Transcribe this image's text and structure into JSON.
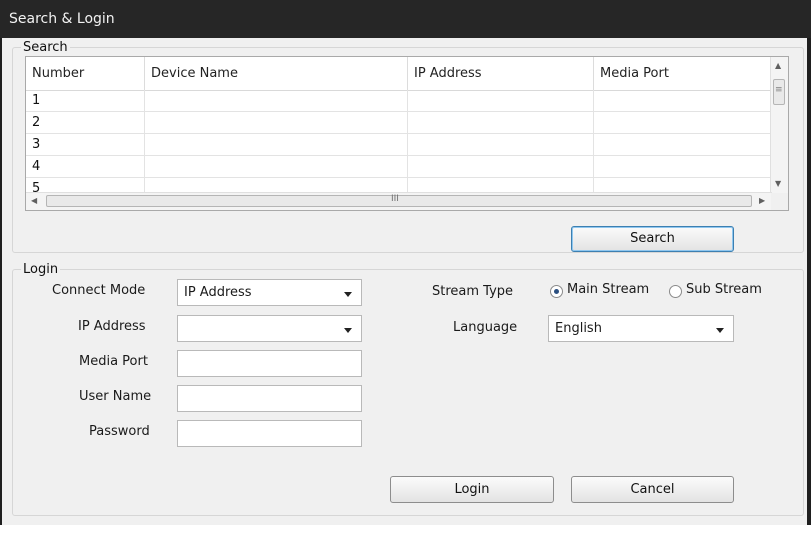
{
  "window": {
    "title": "Search & Login"
  },
  "search": {
    "group_title": "Search",
    "columns": [
      "Number",
      "Device Name",
      "IP Address",
      "Media Port"
    ],
    "rows": [
      [
        "1",
        "",
        "",
        ""
      ],
      [
        "2",
        "",
        "",
        ""
      ],
      [
        "3",
        "",
        "",
        ""
      ],
      [
        "4",
        "",
        "",
        ""
      ],
      [
        "5",
        "",
        "",
        ""
      ]
    ],
    "hscroll_grip": "III",
    "vscroll_grip": "≡",
    "search_button": "Search"
  },
  "login": {
    "group_title": "Login",
    "connect_mode": {
      "label": "Connect Mode",
      "value": "IP Address"
    },
    "ip_address": {
      "label": "IP Address",
      "value": ""
    },
    "media_port": {
      "label": "Media Port",
      "value": ""
    },
    "user_name": {
      "label": "User Name",
      "value": ""
    },
    "password": {
      "label": "Password",
      "value": ""
    },
    "stream_type": {
      "label": "Stream Type",
      "options": [
        "Main Stream",
        "Sub Stream"
      ],
      "selected": "Main Stream"
    },
    "language": {
      "label": "Language",
      "value": "English"
    },
    "login_button": "Login",
    "cancel_button": "Cancel"
  }
}
